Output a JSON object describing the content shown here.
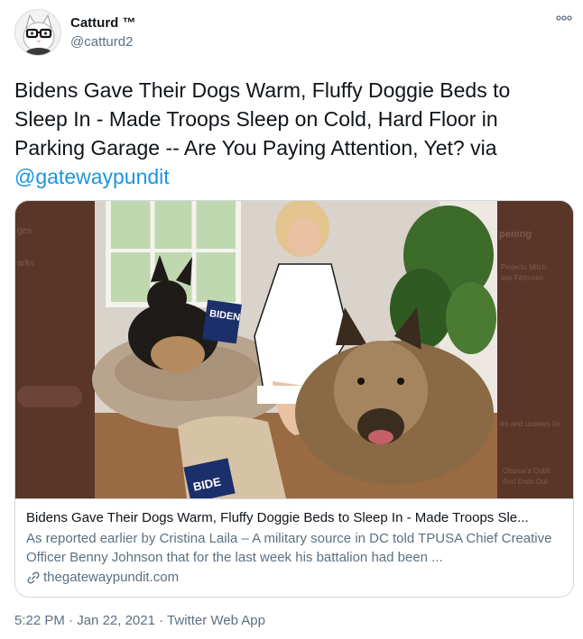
{
  "author": {
    "display_name": "Catturd ™",
    "handle": "@catturd2",
    "avatar_icon": "cat-with-glasses-avatar"
  },
  "more_icon": "ellipsis-icon",
  "tweet": {
    "text": "Bidens Gave Their Dogs Warm, Fluffy Doggie Beds to Sleep In - Made Troops Sleep on Cold, Hard Floor in Parking Garage -- Are You Paying Attention, Yet? via ",
    "mention": "@gatewaypundit"
  },
  "card": {
    "image_banner_text": "BIDEN",
    "image_banner_text_2": "BIDE",
    "bg_sidebar_right": [
      "pening",
      "Projects Mitch",
      "iate Filibuster",
      "rks and updates for",
      "Obama's Outfit",
      "And Ends Out"
    ],
    "bg_sidebar_left": [
      "ges",
      "arks"
    ],
    "title": "Bidens Gave Their Dogs Warm, Fluffy Doggie Beds to Sleep In - Made Troops Sle...",
    "description": "As reported earlier by Cristina Laila – A military source in DC told TPUSA Chief Creative Officer Benny Johnson that for the last week his battalion had been ...",
    "domain": "thegatewaypundit.com"
  },
  "footer": {
    "time": "5:22 PM",
    "sep1": " · ",
    "date": "Jan 22, 2021",
    "sep2": " · ",
    "app": "Twitter Web App"
  },
  "colors": {
    "link": "#1b95e0",
    "secondary_text": "#5b7083",
    "border": "#cfd9de"
  }
}
